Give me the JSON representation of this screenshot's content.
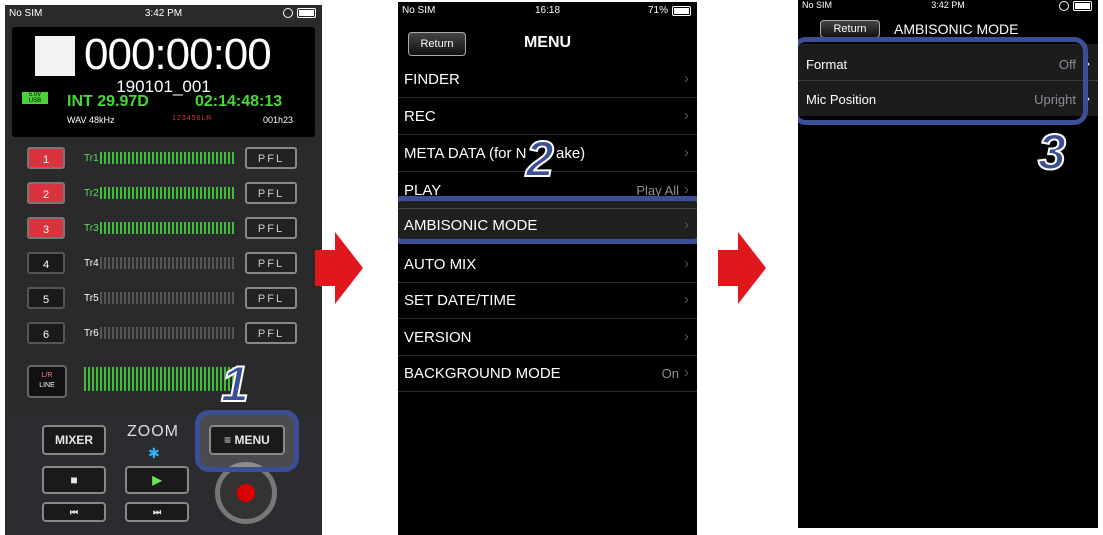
{
  "phone1": {
    "status": {
      "carrier": "No SIM",
      "time": "3:42 PM"
    },
    "display": {
      "timecode": "000:00:00",
      "filename": "190101_001",
      "usb_label": "5.0V USB",
      "frame_rate": "INT 29.97D",
      "timecode_sub": "02:14:48:13",
      "format": "WAV 48kHz",
      "track_indicators": "123456LR",
      "remaining": "001h23"
    },
    "tracks": [
      {
        "num": "1",
        "name": "Tr1",
        "armed": true
      },
      {
        "num": "2",
        "name": "Tr2",
        "armed": true
      },
      {
        "num": "3",
        "name": "Tr3",
        "armed": true
      },
      {
        "num": "4",
        "name": "Tr4",
        "armed": false
      },
      {
        "num": "5",
        "name": "Tr5",
        "armed": false
      },
      {
        "num": "6",
        "name": "Tr6",
        "armed": false
      }
    ],
    "pfl_label": "PFL",
    "lr_label": "L/R",
    "line_label": "LINE",
    "mixer_label": "MIXER",
    "logo": "ZOOM",
    "menu_label": "≡ MENU",
    "stop_glyph": "■",
    "play_glyph": "▶",
    "rew_glyph": "⏮",
    "ff_glyph": "⏭",
    "step_number": "1"
  },
  "phone2": {
    "status": {
      "carrier": "No SIM",
      "time": "16:18",
      "battery": "71%"
    },
    "return_label": "Return",
    "title": "MENU",
    "items": [
      {
        "label": "FINDER",
        "value": ""
      },
      {
        "label": "REC",
        "value": ""
      },
      {
        "label": "META DATA (for N",
        "value": ""
      },
      {
        "label": "PLAY",
        "value": "Play All"
      },
      {
        "label": "AMBISONIC MODE",
        "value": ""
      },
      {
        "label": "AUTO MIX",
        "value": ""
      },
      {
        "label": "SET DATE/TIME",
        "value": ""
      },
      {
        "label": "VERSION",
        "value": ""
      },
      {
        "label": "BACKGROUND MODE",
        "value": "On"
      }
    ],
    "meta_suffix": "ake)",
    "step_number": "2"
  },
  "phone3": {
    "status": {
      "carrier": "No SIM",
      "time": "3:42 PM"
    },
    "return_label": "Return",
    "title": "AMBISONIC MODE",
    "rows": [
      {
        "label": "Format",
        "value": "Off"
      },
      {
        "label": "Mic Position",
        "value": "Upright"
      }
    ],
    "step_number": "3"
  },
  "colors": {
    "highlight": "#3c4f96",
    "arrow": "#e1171e",
    "meter_green": "#3fbe3a",
    "armed_red": "#d9333e"
  }
}
